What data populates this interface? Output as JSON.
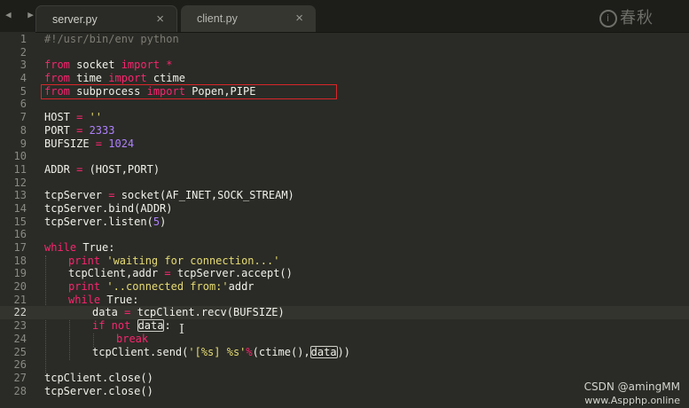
{
  "tabs": [
    {
      "label": "server.py",
      "active": true
    },
    {
      "label": "client.py",
      "active": false
    }
  ],
  "close_glyph": "×",
  "nav_glyph": "◀ ▶",
  "watermark": {
    "logo": "i",
    "text": "春秋"
  },
  "current_line": 22,
  "lines": [
    "1",
    "2",
    "3",
    "4",
    "5",
    "6",
    "7",
    "8",
    "9",
    "10",
    "11",
    "12",
    "13",
    "14",
    "15",
    "16",
    "17",
    "18",
    "19",
    "20",
    "21",
    "22",
    "23",
    "24",
    "25",
    "26",
    "27",
    "28"
  ],
  "code": {
    "shebang": "#!/usr/bin/env python",
    "l3": {
      "k1": "from",
      "mod": " socket ",
      "k2": "import",
      "rest": " *"
    },
    "l4": {
      "k1": "from",
      "mod": " time ",
      "k2": "import",
      "rest": " ctime"
    },
    "l5": {
      "k1": "from",
      "mod": " subprocess ",
      "k2": "import",
      "rest": " Popen,PIPE"
    },
    "l7": {
      "lhs": "HOST ",
      "op": "=",
      "val": " ''"
    },
    "l8": {
      "lhs": "PORT ",
      "op": "=",
      "val": " 2333"
    },
    "l9": {
      "lhs": "BUFSIZE ",
      "op": "=",
      "val": " 1024"
    },
    "l11": {
      "lhs": "ADDR ",
      "op": "=",
      "rest": " (HOST,PORT)"
    },
    "l13": {
      "lhs": "tcpServer ",
      "op": "=",
      "rest": " socket(AF_INET,SOCK_STREAM)"
    },
    "l14": "tcpServer.bind(ADDR)",
    "l15": {
      "pre": "tcpServer.listen(",
      "num": "5",
      "post": ")"
    },
    "l17": {
      "kw": "while",
      "rest": " True:"
    },
    "l18": {
      "kw": "print",
      "str": " 'waiting for connection...'"
    },
    "l19": {
      "lhs": "tcpClient,addr ",
      "op": "=",
      "rest": " tcpServer.accept()"
    },
    "l20": {
      "kw": "print",
      "str": " '..connected from:'",
      "rest": "addr"
    },
    "l21": {
      "kw": "while",
      "rest": " True:"
    },
    "l22": {
      "lhs": "data",
      "op": " = ",
      "rest": "tcpClient.recv(BUFSIZE)"
    },
    "l23": {
      "kw1": "if",
      "kw2": " not ",
      "var": "data",
      "rest": ":"
    },
    "l24": "break",
    "l25": {
      "pre": "tcpClient.send(",
      "str": "'[%s] %s'",
      "op": "%",
      "mid": "(ctime(),",
      "var": "data",
      "post": "))"
    },
    "l27": "tcpClient.close()",
    "l28": "tcpServer.close()"
  },
  "footer": {
    "csdn": "CSDN @amingMM",
    "site": "www.Aspphp.online"
  },
  "colors": {
    "keyword": "#f9256f",
    "number": "#ae81ff",
    "string": "#e6db74",
    "highlight_box": "#d8262a",
    "background": "#2a2b26"
  }
}
